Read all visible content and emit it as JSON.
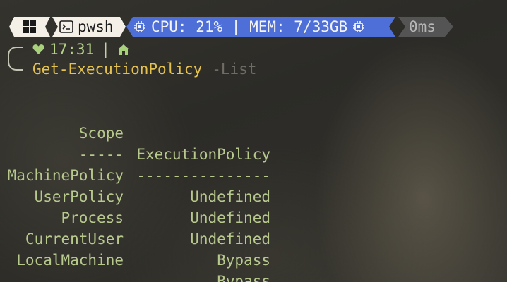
{
  "colors": {
    "segment_light": "#f4f0e8",
    "segment_stats": "#4f6fd8",
    "segment_time": "#545454",
    "output_text": "#b7c98d",
    "command": "#e5c24f",
    "parameter": "#6f6d63"
  },
  "prompt": {
    "os_icon": "windows-logo-icon",
    "shell_icon": "terminal-icon",
    "shell_name": "pwsh",
    "stats_icon": "cpu-chip-icon",
    "stats_text": "CPU: 21% | MEM: 7/33GB",
    "exec_time": "0ms",
    "status_icon": "heart-icon",
    "clock": "17:31",
    "separator": "|",
    "location_icon": "home-icon"
  },
  "command": {
    "name": "Get-ExecutionPolicy",
    "parameter": "-List"
  },
  "table": {
    "headers": [
      "Scope",
      "ExecutionPolicy"
    ],
    "underlines": [
      "-----",
      "---------------"
    ],
    "rows": [
      {
        "scope": "MachinePolicy",
        "policy": "Undefined"
      },
      {
        "scope": "UserPolicy",
        "policy": "Undefined"
      },
      {
        "scope": "Process",
        "policy": "Undefined"
      },
      {
        "scope": "CurrentUser",
        "policy": "Bypass"
      },
      {
        "scope": "LocalMachine",
        "policy": "Bypass"
      }
    ]
  }
}
